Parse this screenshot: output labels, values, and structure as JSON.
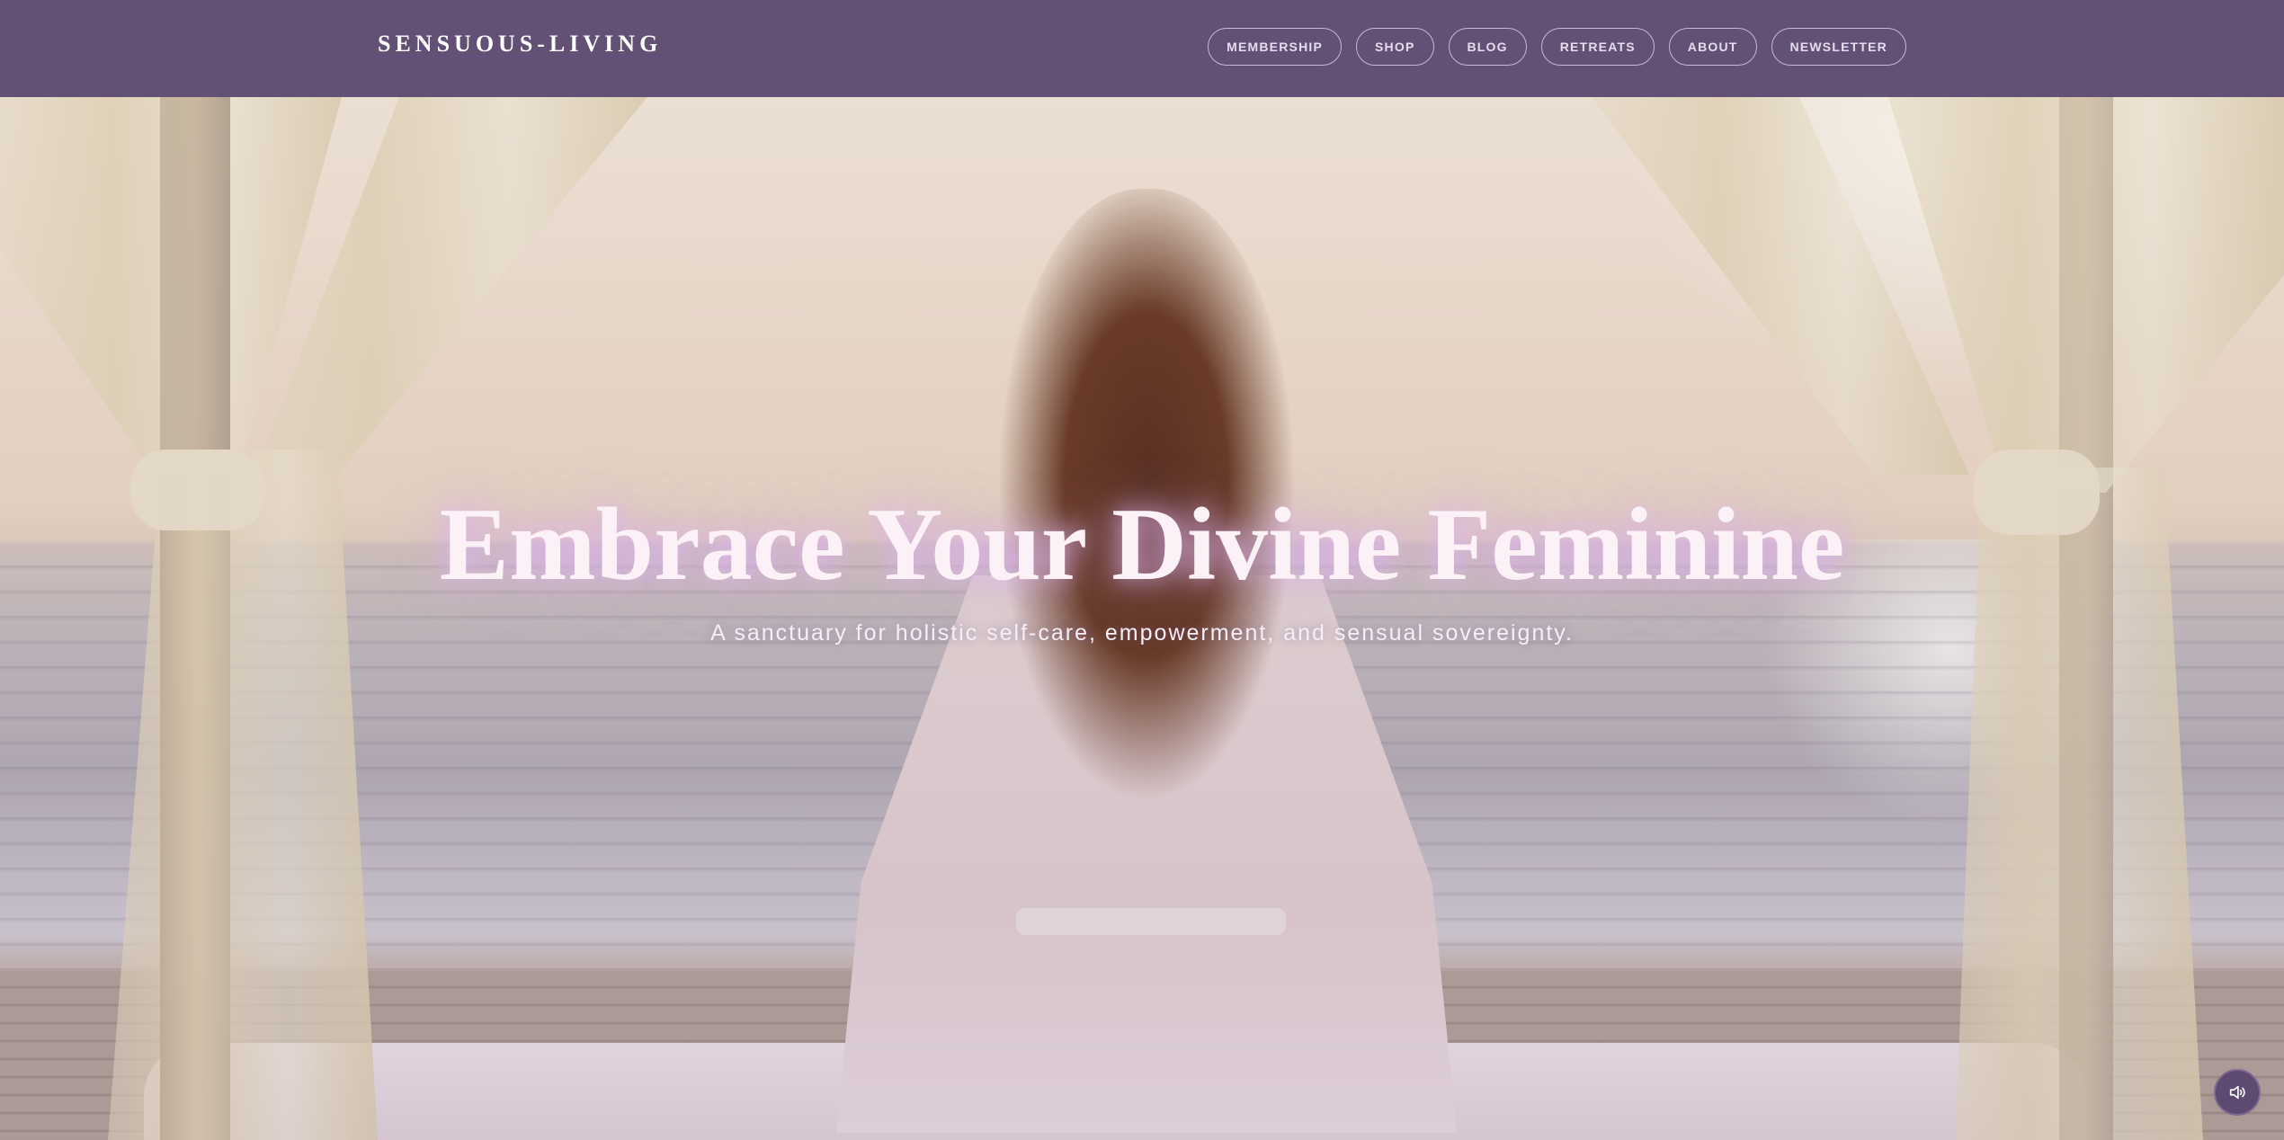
{
  "header": {
    "brand": "SENSUOUS-LIVING",
    "nav": [
      {
        "label": "MEMBERSHIP"
      },
      {
        "label": "SHOP"
      },
      {
        "label": "BLOG"
      },
      {
        "label": "RETREATS"
      },
      {
        "label": "ABOUT"
      },
      {
        "label": "NEWSLETTER"
      }
    ]
  },
  "hero": {
    "title": "Embrace Your Divine Feminine",
    "subtitle": "A sanctuary for holistic self-care, empowerment, and sensual sovereignty.",
    "background": "woman-in-robe-seated-on-canopy-bed-facing-ocean-at-sunrise"
  },
  "controls": {
    "sound_icon": "speaker-volume-icon"
  },
  "colors": {
    "nav_bg": "#5c4a70",
    "title_glow": "#deb4f0",
    "sound_button": "#5e4a70"
  }
}
